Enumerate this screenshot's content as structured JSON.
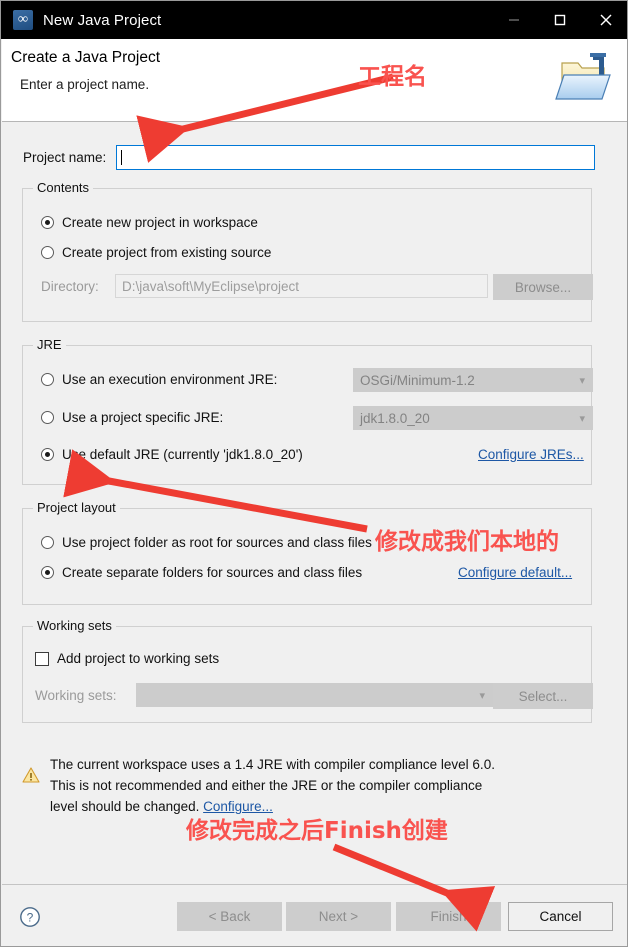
{
  "window": {
    "title": "New Java Project",
    "icon": "myeclipse-icon",
    "minimize_label": "Minimize",
    "maximize_label": "Maximize",
    "close_label": "Close"
  },
  "header": {
    "title": "Create a Java Project",
    "subtitle": "Enter a project name.",
    "icon": "new-java-project-folder-icon"
  },
  "form": {
    "project_name_label": "Project name:",
    "project_name_value": "",
    "project_name_placeholder": ""
  },
  "contents": {
    "legend": "Contents",
    "option_new_workspace": "Create new project in workspace",
    "option_existing_source": "Create project from existing source",
    "selected": "option_new_workspace",
    "directory_label": "Directory:",
    "directory_value": "D:\\java\\soft\\MyEclipse\\project",
    "browse_label": "Browse..."
  },
  "jre": {
    "legend": "JRE",
    "option_execution_env": "Use an execution environment JRE:",
    "execution_env_value": "OSGi/Minimum-1.2",
    "option_project_specific": "Use a project specific JRE:",
    "project_specific_value": "jdk1.8.0_20",
    "option_default": "Use default JRE (currently 'jdk1.8.0_20')",
    "selected": "option_default",
    "configure_link": "Configure JREs..."
  },
  "project_layout": {
    "legend": "Project layout",
    "option_project_root": "Use project folder as root for sources and class files",
    "option_separate_folders": "Create separate folders for sources and class files",
    "selected": "option_separate_folders",
    "configure_link": "Configure default..."
  },
  "working_sets": {
    "legend": "Working sets",
    "add_checkbox_label": "Add project to working sets",
    "checked": false,
    "working_sets_label": "Working sets:",
    "working_sets_value": "",
    "select_label": "Select..."
  },
  "warning": {
    "icon": "warning-triangle-icon",
    "line1": "The current workspace uses a 1.4 JRE with compiler compliance level 6.0.",
    "line2": "This is not recommended and either the JRE or the compiler compliance",
    "line3_prefix": "level should be changed. ",
    "link": "Configure..."
  },
  "footer": {
    "help_icon": "help-question-icon",
    "back_label": "< Back",
    "next_label": "Next >",
    "finish_label": "Finish",
    "cancel_label": "Cancel"
  },
  "annotations": {
    "color": "#f9534f",
    "items": [
      {
        "text": "工程名"
      },
      {
        "text": "修改成我们本地的"
      },
      {
        "text": "修改完成之后Finish创建"
      }
    ]
  }
}
